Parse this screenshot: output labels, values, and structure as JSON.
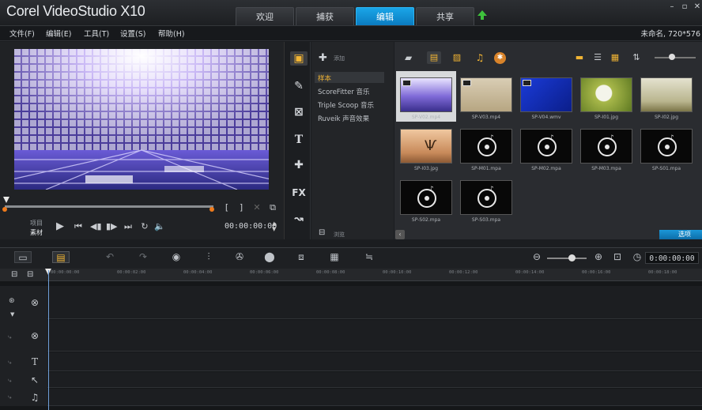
{
  "app": {
    "title": "Corel VideoStudio X10",
    "project_info": "未命名, 720*576"
  },
  "tabs": [
    {
      "label": "欢迎",
      "active": false
    },
    {
      "label": "捕获",
      "active": false
    },
    {
      "label": "编辑",
      "active": true
    },
    {
      "label": "共享",
      "active": false
    }
  ],
  "window_buttons": [
    "–",
    "▫",
    "✕"
  ],
  "menu": [
    "文件(F)",
    "编辑(E)",
    "工具(T)",
    "设置(S)",
    "帮助(H)"
  ],
  "player": {
    "mode_project": "项目",
    "mode_clip": "素材",
    "timecode": "00:00:00:00",
    "brackets": [
      "[",
      "]"
    ]
  },
  "library": {
    "add_label": "添加",
    "folders": [
      "样本",
      "ScoreFitter 音乐",
      "Triple Scoop 音乐",
      "Ruveik 声音效果"
    ],
    "browse_label": "浏览",
    "items": [
      {
        "label": "SP-V02.mp4",
        "kind": "video-purple",
        "selected": true
      },
      {
        "label": "SP-V03.mp4",
        "kind": "video-beige",
        "selected": false
      },
      {
        "label": "SP-V04.wmv",
        "kind": "video-blue",
        "selected": false
      },
      {
        "label": "SP-I01.jpg",
        "kind": "image-flower",
        "selected": false
      },
      {
        "label": "SP-I02.jpg",
        "kind": "image-grass",
        "selected": false
      },
      {
        "label": "SP-I03.jpg",
        "kind": "image-tree",
        "selected": false
      },
      {
        "label": "SP-M01.mpa",
        "kind": "audio",
        "selected": false
      },
      {
        "label": "SP-M02.mpa",
        "kind": "audio",
        "selected": false
      },
      {
        "label": "SP-M03.mpa",
        "kind": "audio",
        "selected": false
      },
      {
        "label": "SP-S01.mpa",
        "kind": "audio",
        "selected": false
      },
      {
        "label": "SP-S02.mpa",
        "kind": "audio",
        "selected": false
      },
      {
        "label": "SP-S03.mpa",
        "kind": "audio",
        "selected": false
      }
    ],
    "options_label": "选项"
  },
  "timeline": {
    "timecode": "0:00:00:00",
    "ruler": [
      "00:00:00:00",
      "00:00:02:00",
      "00:00:04:00",
      "00:00:06:00",
      "00:00:08:00",
      "00:00:10:00",
      "00:00:12:00",
      "00:00:14:00",
      "00:00:16:00",
      "00:00:18:00"
    ]
  }
}
